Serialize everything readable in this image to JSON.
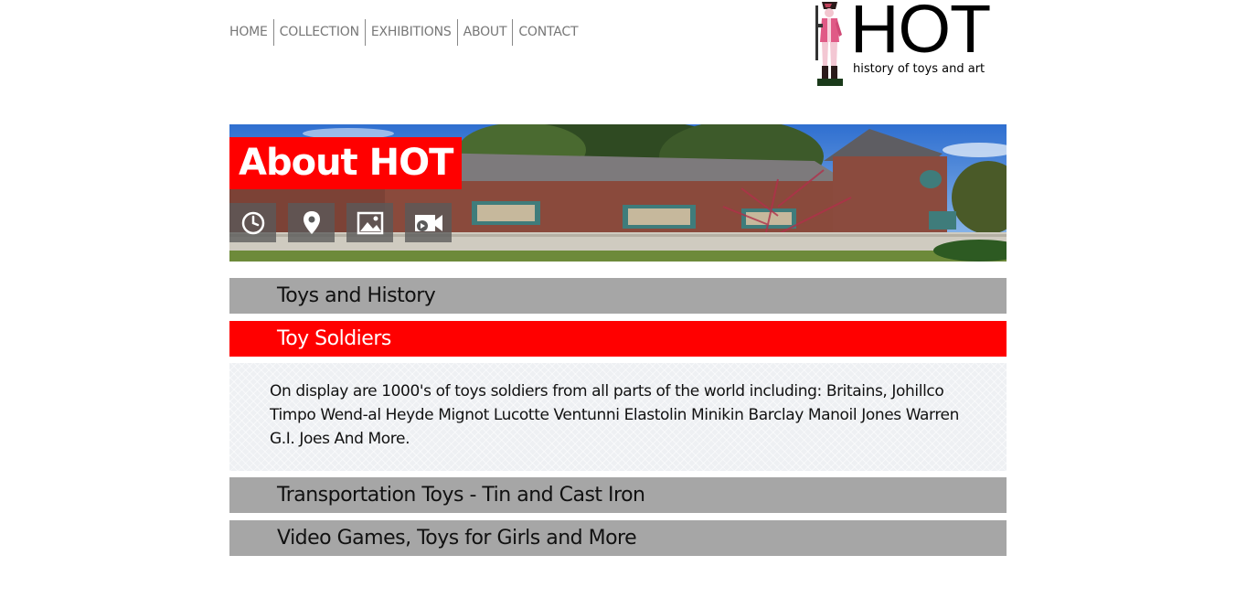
{
  "nav": {
    "items": [
      {
        "label": "HOME"
      },
      {
        "label": "COLLECTION"
      },
      {
        "label": "EXHIBITIONS"
      },
      {
        "label": "ABOUT"
      },
      {
        "label": "CONTACT"
      }
    ]
  },
  "logo": {
    "title": "HOT",
    "tagline": "history of toys and art"
  },
  "hero": {
    "title": "About HOT",
    "icons": [
      "clock-icon",
      "map-pin-icon",
      "image-icon",
      "video-camera-icon"
    ]
  },
  "accordion": {
    "sections": [
      {
        "label": "Toys and History",
        "expanded": false
      },
      {
        "label": "Toy Soldiers",
        "expanded": true
      },
      {
        "label": "Transportation Toys - Tin and Cast Iron",
        "expanded": false
      },
      {
        "label": "Video Games, Toys for Girls and More",
        "expanded": false
      }
    ],
    "open_content": "On display are 1000's of toys soldiers from all parts of the world including: Britains, Johillco Timpo Wend-al Heyde Mignot Lucotte Ventunni Elastolin Minikin Barclay Manoil Jones Warren G.I. Joes And More."
  },
  "colors": {
    "accent": "#ff0000",
    "bar": "#a6a6a6",
    "nav_text": "#777777"
  }
}
